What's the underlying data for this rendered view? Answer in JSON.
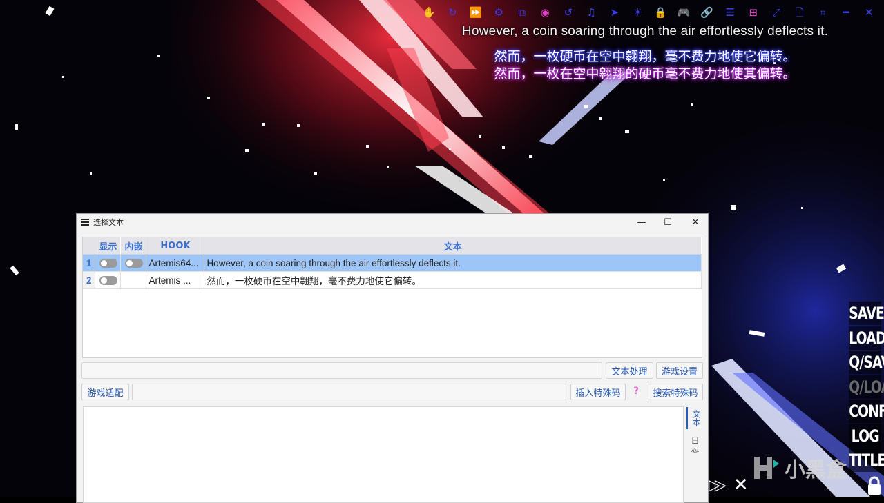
{
  "toolbar": {
    "icons": [
      {
        "name": "hand-icon",
        "glyph": "✋",
        "color": "#3a3cf0"
      },
      {
        "name": "refresh-icon",
        "glyph": "↻",
        "color": "#3a3cf0"
      },
      {
        "name": "fast-forward-icon",
        "glyph": "⏩",
        "color": "#e040c8"
      },
      {
        "name": "gear-icon",
        "glyph": "⚙",
        "color": "#3a3cf0"
      },
      {
        "name": "copy-icon",
        "glyph": "⧉",
        "color": "#3a3cf0"
      },
      {
        "name": "eye-icon",
        "glyph": "◉",
        "color": "#e040c8"
      },
      {
        "name": "undo-icon",
        "glyph": "↺",
        "color": "#3a3cf0"
      },
      {
        "name": "music-icon",
        "glyph": "♫",
        "color": "#3a3cf0"
      },
      {
        "name": "pointer-icon",
        "glyph": "➤",
        "color": "#3a3cf0"
      },
      {
        "name": "lightbulb-icon",
        "glyph": "☀",
        "color": "#3a3cf0"
      },
      {
        "name": "lock-icon",
        "glyph": "🔒",
        "color": "#e040c8"
      },
      {
        "name": "gamepad-icon",
        "glyph": "🎮",
        "color": "#3a3cf0"
      },
      {
        "name": "link-icon",
        "glyph": "🔗",
        "color": "#3a3cf0"
      },
      {
        "name": "menu-icon",
        "glyph": "☰",
        "color": "#3a3cf0"
      },
      {
        "name": "windows-icon",
        "glyph": "⊞",
        "color": "#e040c8"
      },
      {
        "name": "resize-icon",
        "glyph": "⤢",
        "color": "#3a3cf0"
      },
      {
        "name": "document-icon",
        "glyph": "🗋",
        "color": "#3a3cf0"
      },
      {
        "name": "crop-icon",
        "glyph": "⌗",
        "color": "#3a3cf0"
      },
      {
        "name": "minimize-icon",
        "glyph": "━",
        "color": "#3a3cf0"
      },
      {
        "name": "close-icon",
        "glyph": "✕",
        "color": "#3a3cf0"
      }
    ]
  },
  "overlay": {
    "original": "However, a coin soaring through the air effortlessly deflects it.",
    "translation_1": "然而，一枚硬币在空中翱翔，毫不费力地使它偏转。",
    "translation_2": "然而，一枚在空中翱翔的硬币毫不费力地使其偏转。"
  },
  "game_menu": {
    "items": [
      "SAVE",
      "LOAD",
      "Q/SAVE",
      "Q/LOAD",
      "CONFIG",
      "LOG",
      "TITLE"
    ]
  },
  "watermark": {
    "text": "小黑盒"
  },
  "dialog": {
    "title": "选择文本",
    "minimize": "—",
    "maximize": "☐",
    "close": "✕",
    "columns": [
      "显示",
      "内嵌",
      "HOOK",
      "文本"
    ],
    "rows": [
      {
        "num": "1",
        "hook": "Artemis64...",
        "text": "However, a coin soaring through the air effortlessly deflects it.",
        "has_embed": true
      },
      {
        "num": "2",
        "hook": "Artemis ...",
        "text": "然而，一枚硬币在空中翱翔，毫不费力地使它偏转。",
        "has_embed": false
      }
    ],
    "text_process_button": "文本处理",
    "game_settings_button": "游戏设置",
    "game_adapt_button": "游戏适配",
    "insert_special_code_button": "插入特殊码",
    "help_mark": "?",
    "search_special_code_button": "搜索特殊码",
    "side_tab_text": "文本",
    "side_tab_log": "日志"
  },
  "colors": {
    "toolbar_blue": "#3a3cf0",
    "toolbar_pink": "#e040c8",
    "selected_row": "#9ec5f8",
    "header_text": "#3a6fd0"
  }
}
